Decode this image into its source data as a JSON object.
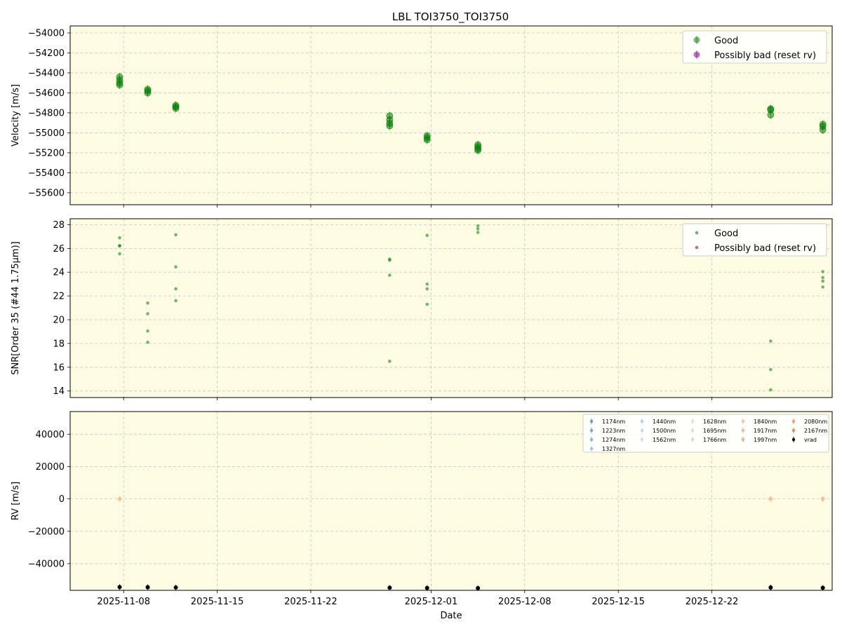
{
  "figure": {
    "title": "LBL TOI3750_TOI3750",
    "background": "#ffffff",
    "axes_facecolor": "#fdfbe2",
    "grid_color": "#c8c8c8",
    "good_color": "#008000",
    "bad_color": "#800080"
  },
  "chart_data": [
    {
      "type": "scatter",
      "id": "velocity",
      "xlabel": "",
      "ylabel": "Velocity [m/s]",
      "x_is_date": true,
      "xlim": [
        "2025-11-04",
        "2025-12-31"
      ],
      "ylim": [
        -55720,
        -53930
      ],
      "yticks": [
        -55600,
        -55400,
        -55200,
        -55000,
        -54800,
        -54600,
        -54400,
        -54200,
        -54000
      ],
      "ytick_labels": [
        "−55600",
        "−55400",
        "−55200",
        "−55000",
        "−54800",
        "−54600",
        "−54400",
        "−54200",
        "−54000"
      ],
      "grid": true,
      "legend_position": "top-right",
      "legend": [
        "Good",
        "Possibly bad (reset rv)"
      ],
      "series": [
        {
          "name": "Good",
          "color": "#008000",
          "points": [
            [
              "2025-11-07.7",
              -54440
            ],
            [
              "2025-11-07.7",
              -54470
            ],
            [
              "2025-11-07.7",
              -54500
            ],
            [
              "2025-11-07.7",
              -54520
            ],
            [
              "2025-11-09.8",
              -54565
            ],
            [
              "2025-11-09.8",
              -54580
            ],
            [
              "2025-11-09.8",
              -54600
            ],
            [
              "2025-11-11.9",
              -54725
            ],
            [
              "2025-11-11.9",
              -54740
            ],
            [
              "2025-11-11.9",
              -54755
            ],
            [
              "2025-11-27.9",
              -54830
            ],
            [
              "2025-11-27.9",
              -54870
            ],
            [
              "2025-11-27.9",
              -54905
            ],
            [
              "2025-11-27.9",
              -54930
            ],
            [
              "2025-11-30.7",
              -55030
            ],
            [
              "2025-11-30.7",
              -55050
            ],
            [
              "2025-11-30.7",
              -55070
            ],
            [
              "2025-12-04.5",
              -55120
            ],
            [
              "2025-12-04.5",
              -55140
            ],
            [
              "2025-12-04.5",
              -55160
            ],
            [
              "2025-12-04.5",
              -55175
            ],
            [
              "2025-12-26.4",
              -54760
            ],
            [
              "2025-12-26.4",
              -54770
            ],
            [
              "2025-12-26.4",
              -54820
            ],
            [
              "2025-12-30.3",
              -54915
            ],
            [
              "2025-12-30.3",
              -54935
            ],
            [
              "2025-12-30.3",
              -54970
            ]
          ]
        },
        {
          "name": "Possibly bad (reset rv)",
          "color": "#800080",
          "points": []
        }
      ]
    },
    {
      "type": "scatter",
      "id": "snr",
      "xlabel": "",
      "ylabel": "SNR[Order 35 (#44 1.75μm)]",
      "x_is_date": true,
      "xlim": [
        "2025-11-04",
        "2025-12-31"
      ],
      "ylim": [
        13.45,
        28.5
      ],
      "yticks": [
        14,
        16,
        18,
        20,
        22,
        24,
        26,
        28
      ],
      "ytick_labels": [
        "14",
        "16",
        "18",
        "20",
        "22",
        "24",
        "26",
        "28"
      ],
      "grid": true,
      "legend_position": "top-right",
      "legend": [
        "Good",
        "Possibly bad (reset rv)"
      ],
      "series": [
        {
          "name": "Good",
          "color": "#008000",
          "points": [
            [
              "2025-11-07.7",
              26.9
            ],
            [
              "2025-11-07.7",
              26.25
            ],
            [
              "2025-11-07.7",
              26.2
            ],
            [
              "2025-11-07.7",
              25.55
            ],
            [
              "2025-11-09.8",
              21.4
            ],
            [
              "2025-11-09.8",
              20.5
            ],
            [
              "2025-11-09.8",
              19.05
            ],
            [
              "2025-11-09.8",
              18.1
            ],
            [
              "2025-11-11.9",
              27.15
            ],
            [
              "2025-11-11.9",
              24.45
            ],
            [
              "2025-11-11.9",
              22.6
            ],
            [
              "2025-11-11.9",
              21.6
            ],
            [
              "2025-11-27.9",
              25.1
            ],
            [
              "2025-11-27.9",
              25.0
            ],
            [
              "2025-11-27.9",
              23.75
            ],
            [
              "2025-11-27.9",
              16.5
            ],
            [
              "2025-11-30.7",
              27.1
            ],
            [
              "2025-11-30.7",
              23.0
            ],
            [
              "2025-11-30.7",
              22.6
            ],
            [
              "2025-11-30.7",
              21.3
            ],
            [
              "2025-12-04.5",
              27.9
            ],
            [
              "2025-12-04.5",
              27.65
            ],
            [
              "2025-12-04.5",
              27.35
            ],
            [
              "2025-12-26.4",
              18.2
            ],
            [
              "2025-12-26.4",
              15.8
            ],
            [
              "2025-12-26.4",
              14.1
            ],
            [
              "2025-12-30.3",
              24.05
            ],
            [
              "2025-12-30.3",
              23.55
            ],
            [
              "2025-12-30.3",
              23.25
            ],
            [
              "2025-12-30.3",
              22.75
            ]
          ]
        },
        {
          "name": "Possibly bad (reset rv)",
          "color": "#800080",
          "points": []
        }
      ]
    },
    {
      "type": "scatter",
      "id": "rv",
      "xlabel": "Date",
      "ylabel": "RV [m/s]",
      "x_is_date": true,
      "xlim": [
        "2025-11-04",
        "2025-12-31"
      ],
      "ylim": [
        -56500,
        54000
      ],
      "yticks": [
        -40000,
        -20000,
        0,
        20000,
        40000
      ],
      "ytick_labels": [
        "−40000",
        "−20000",
        "0",
        "20000",
        "40000"
      ],
      "xticks": [
        "2025-11-08",
        "2025-11-15",
        "2025-11-22",
        "2025-12-01",
        "2025-12-08",
        "2025-12-15",
        "2025-12-22"
      ],
      "xtick_labels": [
        "2025-11-08",
        "2025-11-15",
        "2025-11-22",
        "2025-12-01",
        "2025-12-08",
        "2025-12-15",
        "2025-12-22"
      ],
      "grid": true,
      "legend_position": "top-right",
      "legend_columns": [
        [
          "1174nm",
          "1223nm",
          "1274nm",
          "1327nm"
        ],
        [
          "1440nm",
          "1500nm",
          "1562nm"
        ],
        [
          "1628nm",
          "1695nm",
          "1766nm"
        ],
        [
          "1840nm",
          "1917nm",
          "1997nm"
        ],
        [
          "2080nm",
          "2167nm",
          "vrad"
        ]
      ],
      "legend_colors": {
        "1174nm": "#6d8ff0",
        "1223nm": "#7c9df8",
        "1274nm": "#8fadfc",
        "1327nm": "#a3bdfe",
        "1440nm": "#b4cbf8",
        "1500nm": "#c4d5f3",
        "1562nm": "#d3dbec",
        "1628nm": "#dfdcd9",
        "1695nm": "#e8d6cc",
        "1766nm": "#eecfbf",
        "1840nm": "#f4c3aa",
        "1917nm": "#f5b69a",
        "1997nm": "#f4a98a",
        "2080nm": "#f09a7a",
        "2167nm": "#e8866a",
        "vrad": "#000000"
      },
      "series": [
        {
          "name": "1997nm",
          "color": "#f4a98a",
          "points": [
            [
              "2025-11-07.7",
              0
            ],
            [
              "2025-12-26.4",
              0
            ],
            [
              "2025-12-30.3",
              0
            ]
          ]
        },
        {
          "name": "2167nm",
          "color": "#e8866a",
          "points": [
            [
              "2025-11-07.7",
              -54400
            ],
            [
              "2025-11-09.8",
              -54300
            ],
            [
              "2025-12-26.4",
              -54600
            ]
          ]
        },
        {
          "name": "vrad",
          "color": "#000000",
          "points": [
            [
              "2025-11-07.7",
              -54500
            ],
            [
              "2025-11-09.8",
              -54580
            ],
            [
              "2025-11-11.9",
              -54740
            ],
            [
              "2025-11-27.9",
              -54890
            ],
            [
              "2025-11-30.7",
              -55050
            ],
            [
              "2025-12-04.5",
              -55150
            ],
            [
              "2025-12-26.4",
              -54790
            ],
            [
              "2025-12-30.3",
              -54940
            ]
          ]
        }
      ]
    }
  ]
}
